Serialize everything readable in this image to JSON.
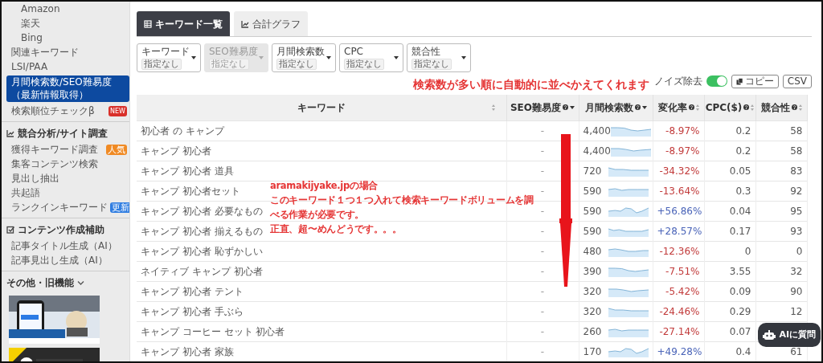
{
  "sidebar": {
    "groups": [
      {
        "items": [
          {
            "label": "Amazon",
            "kind": "sub",
            "selected": false
          },
          {
            "label": "楽天",
            "kind": "sub",
            "selected": false
          },
          {
            "label": "Bing",
            "kind": "sub",
            "selected": false
          },
          {
            "label": "関連キーワード",
            "kind": "item",
            "selected": false
          },
          {
            "label": "LSI/PAA",
            "kind": "item",
            "selected": false
          },
          {
            "label_lines": [
              "月間検索数/SEO難易度",
              "（最新情報取得）"
            ],
            "kind": "item",
            "selected": true
          },
          {
            "label": "検索順位チェックβ",
            "kind": "item",
            "selected": false,
            "badge": {
              "text": "NEW",
              "color": "#d9302a"
            }
          }
        ]
      },
      {
        "heading": "競合分析/サイト調査",
        "items": [
          {
            "label": "獲得キーワード調査",
            "kind": "item",
            "selected": false,
            "badge": {
              "text": "人気",
              "color": "#f08a24"
            }
          },
          {
            "label": "集客コンテンツ検索",
            "kind": "item",
            "selected": false
          },
          {
            "label": "見出し抽出",
            "kind": "item",
            "selected": false
          },
          {
            "label": "共起語",
            "kind": "item",
            "selected": false
          },
          {
            "label": "ランクインキーワード",
            "kind": "item",
            "selected": false,
            "badge": {
              "text": "更新",
              "color": "#2f7de1"
            }
          }
        ]
      },
      {
        "heading": "コンテンツ作成補助",
        "items": [
          {
            "label": "記事タイトル生成（AI）",
            "kind": "item",
            "selected": false
          },
          {
            "label": "記事見出し生成（AI）",
            "kind": "item",
            "selected": false
          }
        ]
      },
      {
        "heading": "その他・旧機能",
        "expanded": false
      }
    ]
  },
  "tabs": [
    {
      "label": "キーワード一覧",
      "selected": true
    },
    {
      "label": "合計グラフ",
      "selected": false
    }
  ],
  "filters": [
    {
      "label": "キーワード",
      "value": "指定なし",
      "disabled": false
    },
    {
      "label": "SEO難易度",
      "value": "指定なし",
      "disabled": true
    },
    {
      "label": "月間検索数",
      "value": "指定なし",
      "disabled": false
    },
    {
      "label": "CPC",
      "value": "指定なし",
      "disabled": false
    },
    {
      "label": "競合性",
      "value": "指定なし",
      "disabled": false
    }
  ],
  "toolbar": {
    "noise": {
      "label": "ノイズ除去",
      "on": true
    },
    "buttons": [
      "コピー",
      "CSV"
    ]
  },
  "table": {
    "columns": [
      {
        "label": "キーワード",
        "help": false,
        "sort_desc": false
      },
      {
        "label": "SEO難易度",
        "help": true,
        "sort_desc": true
      },
      {
        "label": "月間検索数",
        "help": true,
        "sort_desc": true
      },
      {
        "label": "変化率",
        "help": true,
        "sort_desc": false
      },
      {
        "label": "CPC($)",
        "help": true,
        "sort_desc": false
      },
      {
        "label": "競合性",
        "help": true,
        "sort_desc": false
      }
    ],
    "rows": [
      {
        "keyword": "初心者 の キャンプ",
        "seo": "-",
        "volume": "4,400",
        "change": "-8.97%",
        "rising": false,
        "cpc": "0.2",
        "competition": "58"
      },
      {
        "keyword": "キャンプ 初心者",
        "seo": "-",
        "volume": "4,400",
        "change": "-8.97%",
        "rising": false,
        "cpc": "0.2",
        "competition": "58"
      },
      {
        "keyword": "キャンプ 初心者 道具",
        "seo": "-",
        "volume": "720",
        "change": "-34.32%",
        "rising": false,
        "cpc": "0.05",
        "competition": "83"
      },
      {
        "keyword": "キャンプ 初心者セット",
        "seo": "-",
        "volume": "590",
        "change": "-13.64%",
        "rising": false,
        "cpc": "0.3",
        "competition": "92"
      },
      {
        "keyword": "キャンプ 初心者 必要なもの",
        "seo": "-",
        "volume": "590",
        "change": "+56.86%",
        "rising": true,
        "cpc": "0.04",
        "competition": "95"
      },
      {
        "keyword": "キャンプ 初心者 揃えるもの",
        "seo": "-",
        "volume": "590",
        "change": "+28.57%",
        "rising": true,
        "cpc": "0.17",
        "competition": "93"
      },
      {
        "keyword": "キャンプ 初心者 恥ずかしい",
        "seo": "-",
        "volume": "480",
        "change": "-12.36%",
        "rising": false,
        "cpc": "0",
        "competition": "0"
      },
      {
        "keyword": "ネイティブ キャンプ 初心者",
        "seo": "-",
        "volume": "390",
        "change": "-7.51%",
        "rising": false,
        "cpc": "3.55",
        "competition": "32"
      },
      {
        "keyword": "キャンプ 初心者 テント",
        "seo": "-",
        "volume": "320",
        "change": "-5.42%",
        "rising": false,
        "cpc": "0.09",
        "competition": "90"
      },
      {
        "keyword": "キャンプ 初心者 手ぶら",
        "seo": "-",
        "volume": "320",
        "change": "-24.46%",
        "rising": false,
        "cpc": "0.29",
        "competition": "12"
      },
      {
        "keyword": "キャンプ コーヒー セット 初心者",
        "seo": "-",
        "volume": "260",
        "change": "-27.14%",
        "rising": false,
        "cpc": "0.07"
      },
      {
        "keyword": "キャンプ 初心者 家族",
        "seo": "-",
        "volume": "170",
        "change": "+49.28%",
        "rising": true,
        "cpc": "0.4",
        "competition": "61"
      }
    ]
  },
  "annotations": {
    "heading": "検索数が多い順に自動的に並べかえてくれます",
    "note": {
      "title": "aramakijyake.jpの場合",
      "lines": [
        "このキーワード１つ１つ入れて検索キーワードボリュームを調",
        "べる作業が必要です。",
        "正直、超〜めんどうです。。。"
      ]
    }
  },
  "ai_button": "AIに質問"
}
